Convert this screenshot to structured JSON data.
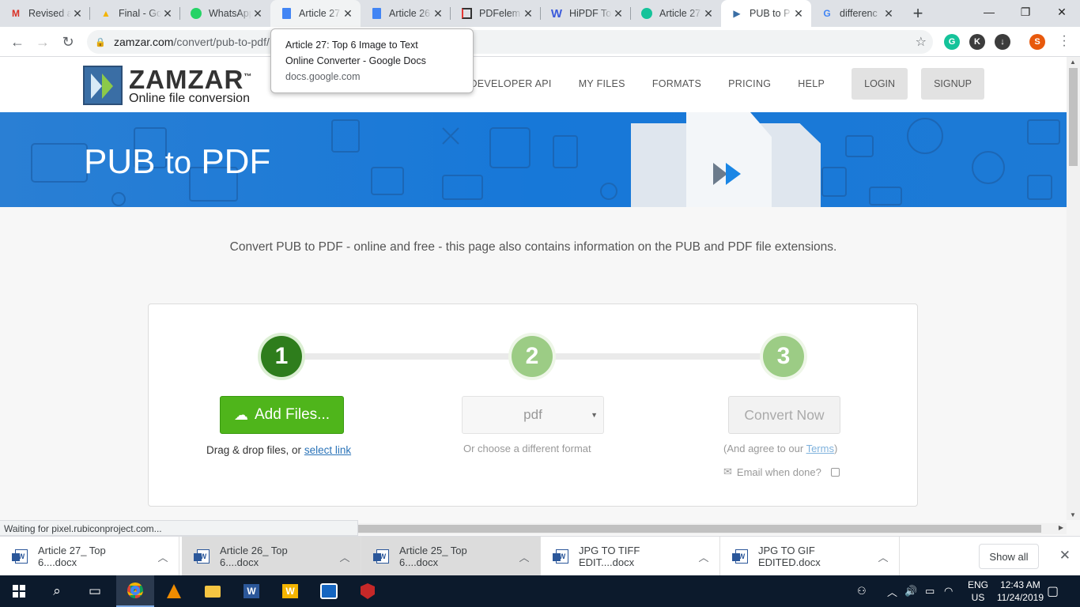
{
  "tabs": [
    {
      "title": "Revised a",
      "icon": "gmail-icon",
      "color": "#d93025"
    },
    {
      "title": "Final - Go",
      "icon": "google-drive-icon",
      "color": "#1a73e8"
    },
    {
      "title": "WhatsApp",
      "icon": "whatsapp-icon",
      "color": "#25d366"
    },
    {
      "title": "Article 27",
      "icon": "google-docs-icon",
      "color": "#4285f4"
    },
    {
      "title": "Article 26",
      "icon": "google-docs-icon",
      "color": "#4285f4"
    },
    {
      "title": "PDFelem",
      "icon": "pdfelement-icon",
      "color": "#e53935"
    },
    {
      "title": "HiPDF To",
      "icon": "hipdf-icon",
      "color": "#3b5bdb"
    },
    {
      "title": "Article 27",
      "icon": "grammarly-icon",
      "color": "#15c39a"
    },
    {
      "title": "PUB to P",
      "icon": "zamzar-icon",
      "color": "#3a6ea5"
    },
    {
      "title": "differenc",
      "icon": "google-icon",
      "color": "#4285f4"
    }
  ],
  "url": {
    "host": "zamzar.com",
    "path": "/convert/pub-to-pdf/"
  },
  "tooltip": {
    "line1": "Article 27: Top 6 Image to Text",
    "line2": "Online Converter - Google Docs",
    "domain": "docs.google.com"
  },
  "extensions": {
    "k_label": "K",
    "profile_label": "S"
  },
  "logo": {
    "name": "ZAMZAR",
    "tm": "™",
    "subtitle": "Online file conversion"
  },
  "nav": {
    "developer_api": "DEVELOPER API",
    "my_files": "MY FILES",
    "formats": "FORMATS",
    "pricing": "PRICING",
    "help": "HELP",
    "login": "LOGIN",
    "signup": "SIGNUP"
  },
  "hero": {
    "from": "PUB",
    "to": "to",
    "target": "PDF"
  },
  "tagline": "Convert PUB to PDF - online and free - this page also contains information on the PUB and PDF file extensions.",
  "steps": {
    "one": "1",
    "two": "2",
    "three": "3"
  },
  "converter": {
    "add_files": "Add Files...",
    "drag_text": "Drag & drop files, or ",
    "select_link": "select link",
    "format_value": "pdf",
    "format_hint": "Or choose a different format",
    "convert_now": "Convert Now",
    "agree_prefix": "(And agree to our ",
    "terms": "Terms",
    "agree_suffix": ")",
    "email_label": "Email when done?"
  },
  "status_text": "Waiting for pixel.rubiconproject.com...",
  "downloads": [
    {
      "name": "Article 27_ Top 6....docx"
    },
    {
      "name": "Article 26_ Top 6....docx"
    },
    {
      "name": "Article 25_ Top 6....docx"
    },
    {
      "name": "JPG TO TIFF EDIT....docx"
    },
    {
      "name": "JPG TO GIF EDITED.docx"
    }
  ],
  "show_all": "Show all",
  "taskbar": {
    "lang_1": "ENG",
    "lang_2": "US",
    "time": "12:43 AM",
    "date": "11/24/2019"
  }
}
